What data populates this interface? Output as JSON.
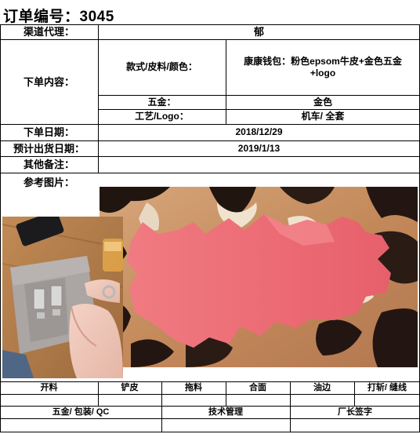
{
  "order": {
    "title": "订单编号：3045",
    "fields": {
      "channel_label": "渠道代理：",
      "channel_value": "郁",
      "content_label": "下单内容：",
      "style_label": "款式/皮料/颜色：",
      "style_value_line1": "康康钱包：粉色epsom牛皮+金色五金",
      "style_value_line2": "+logo",
      "hardware_label": "五金：",
      "hardware_value": "金色",
      "craft_label": "工艺/Logo：",
      "craft_value": "机车/ 全套",
      "order_date_label": "下单日期：",
      "order_date_value": "2018/12/29",
      "ship_date_label": "预计出货日期：",
      "ship_date_value": "2019/1/13",
      "remarks_label": "其他备注：",
      "remarks_value": "",
      "reference_label": "参考图片："
    },
    "process": {
      "row1": [
        "开料",
        "铲皮",
        "拖料",
        "合面",
        "油边",
        "打斩/ 缝线"
      ],
      "row2": [
        "五金/ 包装/ QC",
        "技术管理",
        "厂长签字"
      ]
    }
  },
  "colors": {
    "leather_pink": "#ee6f78",
    "marble_tan": "#c98b5a",
    "marble_dark": "#221612",
    "wood_table": "#b07a46",
    "wallet_grey": "#a9a3a1"
  }
}
